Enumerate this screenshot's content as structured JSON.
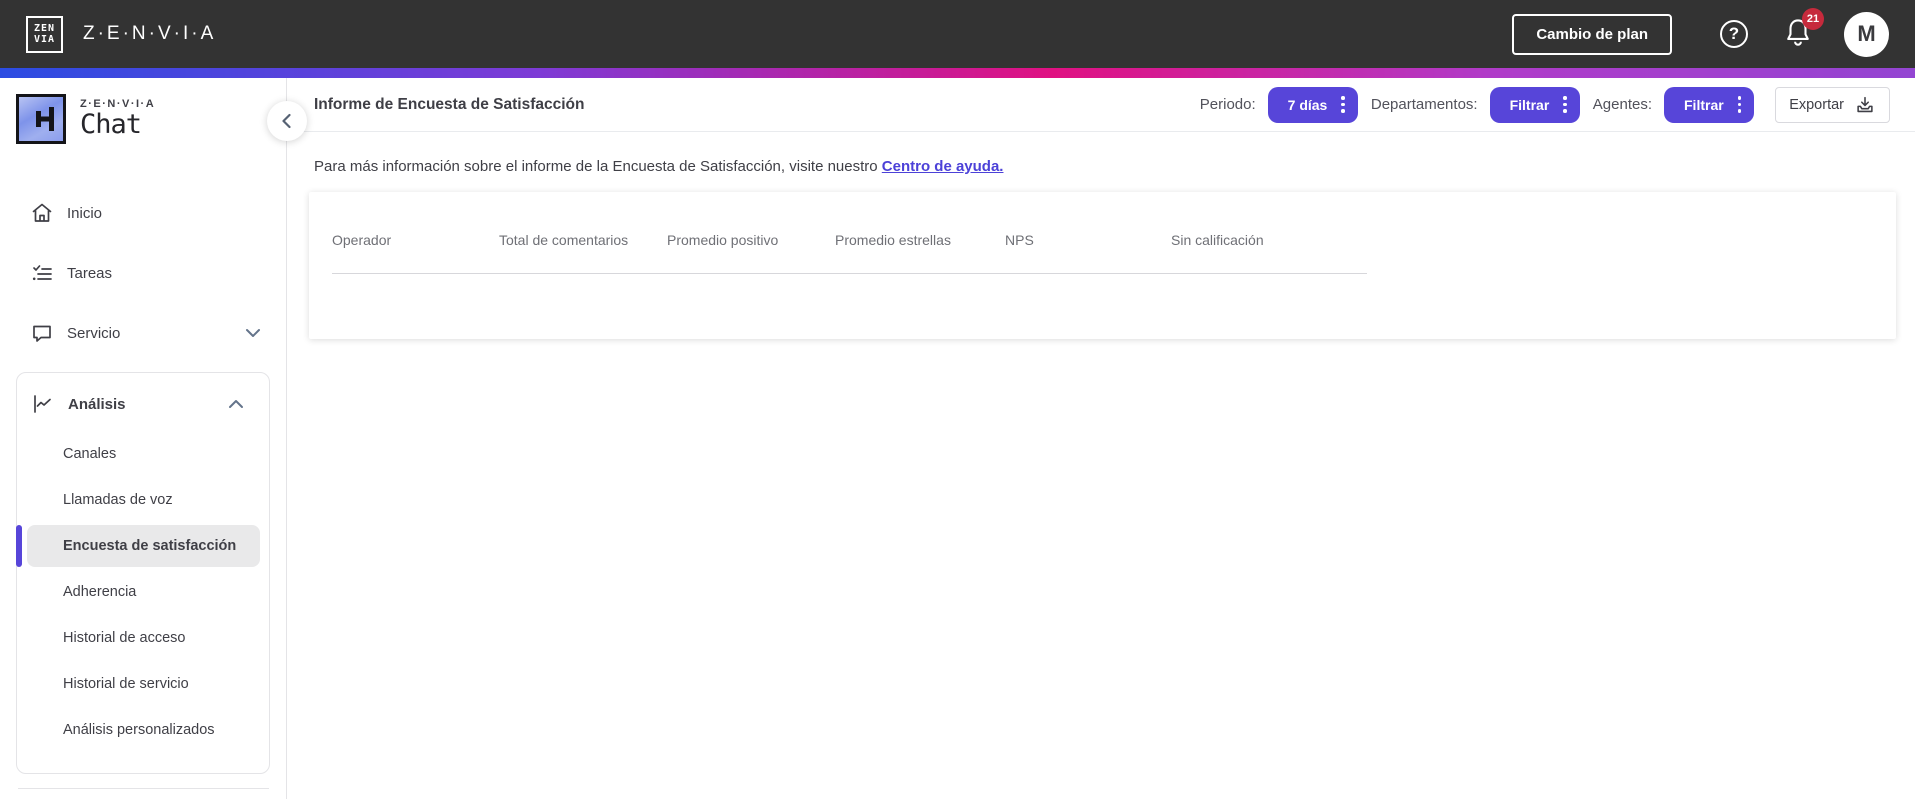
{
  "topbar": {
    "brand": "Z·E·N·V·I·A",
    "logo_line1": "ZEN",
    "logo_line2": "VIA",
    "change_plan_label": "Cambio de plan",
    "help_glyph": "?",
    "notification_count": "21",
    "avatar_initial": "M"
  },
  "sidebar": {
    "logo_brand": "Z·E·N·V·I·A",
    "logo_product": "Chat",
    "items": [
      {
        "label": "Inicio"
      },
      {
        "label": "Tareas"
      },
      {
        "label": "Servicio"
      },
      {
        "label": "Análisis"
      }
    ],
    "analysis_subitems": [
      "Canales",
      "Llamadas de voz",
      "Encuesta de satisfacción",
      "Adherencia",
      "Historial de acceso",
      "Historial de servicio",
      "Análisis personalizados"
    ],
    "active_subitem": "Encuesta de satisfacción"
  },
  "header": {
    "title": "Informe de Encuesta de Satisfacción",
    "period_label": "Periodo:",
    "period_value": "7 días",
    "departments_label": "Departamentos:",
    "departments_value": "Filtrar",
    "agents_label": "Agentes:",
    "agents_value": "Filtrar",
    "export_label": "Exportar"
  },
  "info": {
    "text": "Para más información sobre el informe de la Encuesta de Satisfacción, visite nuestro ",
    "link": "Centro de ayuda."
  },
  "table": {
    "columns": [
      "Operador",
      "Total de comentarios",
      "Promedio positivo",
      "Promedio estrellas",
      "NPS",
      "Sin calificación"
    ],
    "rows": []
  },
  "colors": {
    "accent": "#5745d9",
    "topbar_bg": "#333333",
    "badge_red": "#c62a3c",
    "gradient": [
      "#2b4ce2",
      "#7d3bd6",
      "#e01182",
      "#9345d2"
    ],
    "active_item_bg": "#e9e9ea"
  }
}
